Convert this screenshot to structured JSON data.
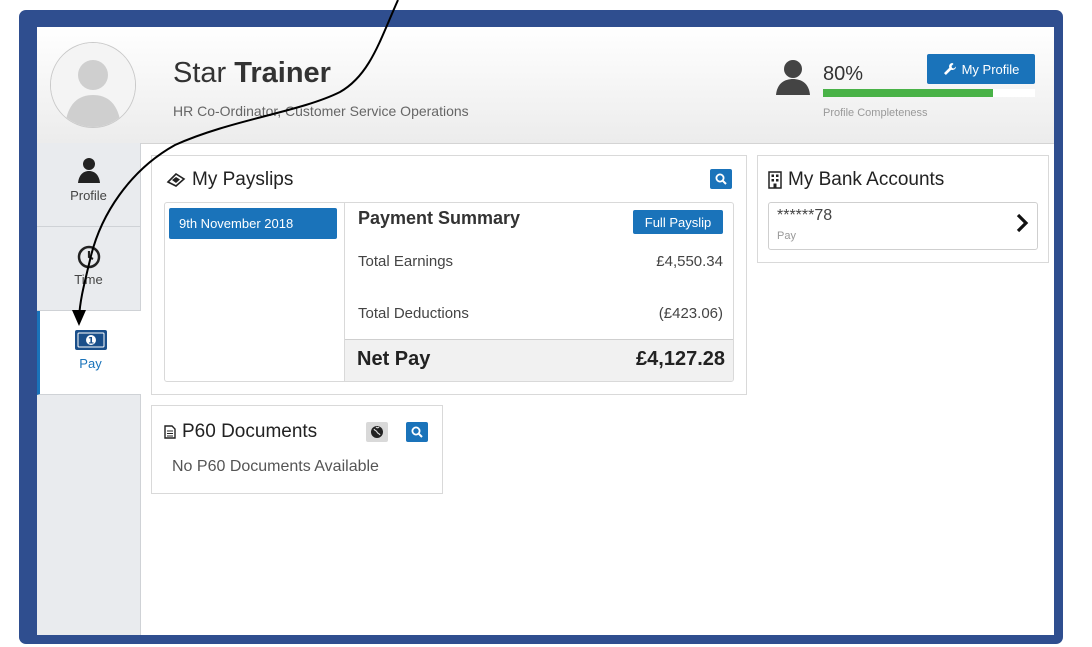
{
  "header": {
    "first_name": "Star",
    "last_name": "Trainer",
    "role": "HR Co-Ordinator, Customer Service Operations",
    "profile_percent": "80%",
    "profile_completeness_fraction": 0.8,
    "completeness_label": "Profile Completeness",
    "my_profile_label": "My Profile"
  },
  "sidebar": {
    "items": [
      {
        "label": "Profile",
        "icon": "user-icon"
      },
      {
        "label": "Time",
        "icon": "clock-icon"
      },
      {
        "label": "Pay",
        "icon": "money-icon",
        "active": true
      }
    ]
  },
  "payslips": {
    "title": "My Payslips",
    "date": "9th November 2018",
    "summary_title": "Payment Summary",
    "full_payslip_label": "Full Payslip",
    "total_earnings_label": "Total Earnings",
    "total_earnings_value": "£4,550.34",
    "total_deductions_label": "Total Deductions",
    "total_deductions_value": "(£423.06)",
    "net_pay_label": "Net Pay",
    "net_pay_value": "£4,127.28"
  },
  "bank": {
    "title": "My Bank Accounts",
    "account_number": "******78",
    "account_type": "Pay"
  },
  "p60": {
    "title": "P60 Documents",
    "empty_message": "No P60 Documents Available"
  },
  "colors": {
    "accent": "#1a73ba",
    "frame": "#2f4e8f",
    "progress": "#49b247"
  }
}
